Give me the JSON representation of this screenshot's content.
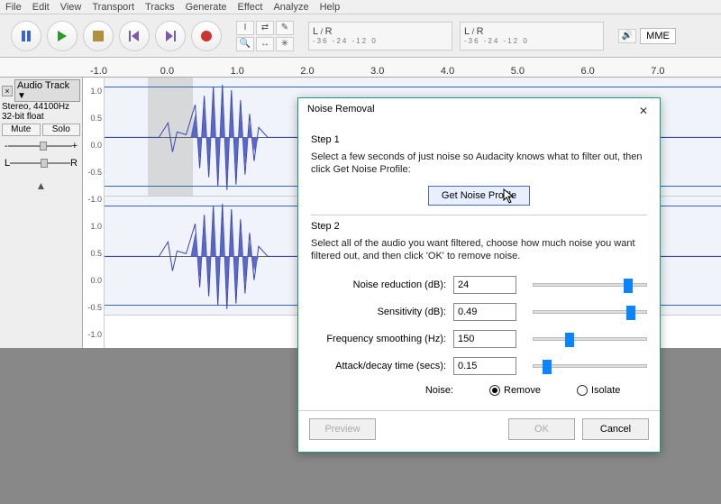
{
  "menu": [
    "File",
    "Edit",
    "View",
    "Transport",
    "Tracks",
    "Generate",
    "Effect",
    "Analyze",
    "Help"
  ],
  "meter": {
    "ticks": "-36  -24  -12  0",
    "left": "L",
    "right": "R"
  },
  "io": {
    "driver": "MME"
  },
  "ruler": [
    "-1.0",
    "0.0",
    "1.0",
    "2.0",
    "3.0",
    "4.0",
    "5.0",
    "6.0",
    "7.0"
  ],
  "track": {
    "name": "Audio Track",
    "info1": "Stereo, 44100Hz",
    "info2": "32-bit float",
    "mute": "Mute",
    "solo": "Solo",
    "panL": "L",
    "panR": "R",
    "scale": [
      "1.0",
      "0.5",
      "0.0",
      "-0.5",
      "-1.0"
    ]
  },
  "dialog": {
    "title": "Noise Removal",
    "step1_label": "Step 1",
    "step1_text": "Select a few seconds of just noise so Audacity knows what to filter out, then click Get Noise Profile:",
    "gnp": "Get Noise Profile",
    "step2_label": "Step 2",
    "step2_text": "Select all of the audio you want filtered, choose how much noise you want filtered out, and then click 'OK' to remove noise.",
    "params": {
      "nr_label": "Noise reduction (dB):",
      "nr": "24",
      "sens_label": "Sensitivity (dB):",
      "sens": "0.49",
      "fs_label": "Frequency smoothing (Hz):",
      "fs": "150",
      "ad_label": "Attack/decay time (secs):",
      "ad": "0.15",
      "noise_label": "Noise:",
      "remove": "Remove",
      "isolate": "Isolate"
    },
    "preview": "Preview",
    "ok": "OK",
    "cancel": "Cancel"
  }
}
